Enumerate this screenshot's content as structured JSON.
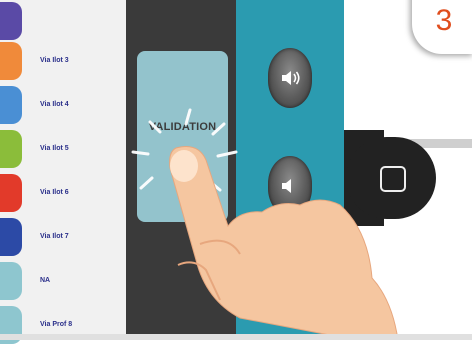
{
  "list": {
    "items": [
      {
        "label": "",
        "color": "#5a4aa6"
      },
      {
        "label": "Via Ilot 3",
        "color": "#f08a3a"
      },
      {
        "label": "Via Ilot 4",
        "color": "#4a8fd4"
      },
      {
        "label": "Via Ilot 5",
        "color": "#8bbd3a"
      },
      {
        "label": "Via Ilot 6",
        "color": "#e23a2a"
      },
      {
        "label": "Via Ilot 7",
        "color": "#2c4aa6"
      },
      {
        "label": "NA",
        "color": "#8ec6cf"
      },
      {
        "label": "Via Prof 8",
        "color": "#8ec6cf"
      }
    ]
  },
  "validation": {
    "label": "VALIDATION",
    "color": "#93c3cc"
  },
  "volume": {
    "up_icon": "volume-up-icon",
    "down_icon": "volume-down-icon"
  },
  "home": {
    "icon": "home-square-icon"
  },
  "badge": {
    "step": "3",
    "color": "#e04e1e"
  },
  "hand": {
    "icon": "pointing-hand-icon"
  }
}
